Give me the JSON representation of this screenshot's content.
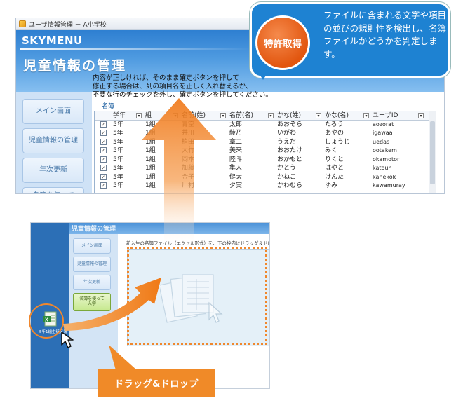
{
  "top_window": {
    "title": "ユーザ情報管理 － A小学校",
    "logo": "SKYMENU",
    "page_title": "児童情報の管理",
    "nav": [
      "メイン画面",
      "児童情報の管理",
      "年次更新",
      "名簿を使って\n入学"
    ],
    "instructions": "内容が正しければ、そのまま確定ボタンを押して\n修正する場合は、列の項目名を正しく入れ替えるか、\n不要な行のチェックを外し、確定ボタンを押してください。",
    "tab": "名簿",
    "columns": [
      "学年",
      "組",
      "名前(姓)",
      "名前(名)",
      "かな(姓)",
      "かな(名)",
      "ユーザID"
    ],
    "rows": [
      [
        "5年",
        "1組",
        "青空",
        "太郎",
        "あおぞら",
        "たろう",
        "aozorat"
      ],
      [
        "5年",
        "1組",
        "井川",
        "綾乃",
        "いがわ",
        "あやの",
        "igawaa"
      ],
      [
        "5年",
        "1組",
        "植田",
        "章二",
        "うえだ",
        "しょうじ",
        "uedas"
      ],
      [
        "5年",
        "1組",
        "大竹",
        "美来",
        "おおたけ",
        "みく",
        "ootakem"
      ],
      [
        "5年",
        "1組",
        "岡本",
        "陸斗",
        "おかもと",
        "りくと",
        "okamotor"
      ],
      [
        "5年",
        "1組",
        "加藤",
        "隼人",
        "かとう",
        "はやと",
        "katouh"
      ],
      [
        "5年",
        "1組",
        "金子",
        "健太",
        "かねこ",
        "けんた",
        "kanekok"
      ],
      [
        "5年",
        "1組",
        "川村",
        "夕実",
        "かわむら",
        "ゆみ",
        "kawamuray"
      ]
    ]
  },
  "callout": {
    "badge": "特許取得",
    "text": "ファイルに含まれる文字や項目の並びの規則性を検出し、名簿ファイルかどうかを判定します。"
  },
  "bottom_window": {
    "title": "児童情報の管理",
    "nav": [
      "メイン画面",
      "児童情報の管理",
      "年次更新",
      "名簿を使って\n入学"
    ],
    "instructions": "新入生の名簿ファイル（エクセル形式）を、下の枠内にドラッグ＆ドロ",
    "file_label": "5年1組生徒名簿"
  },
  "banner": "ドラッグ&ドロップ",
  "colors": {
    "accent_blue": "#1e82d2",
    "accent_orange": "#f08a28"
  }
}
